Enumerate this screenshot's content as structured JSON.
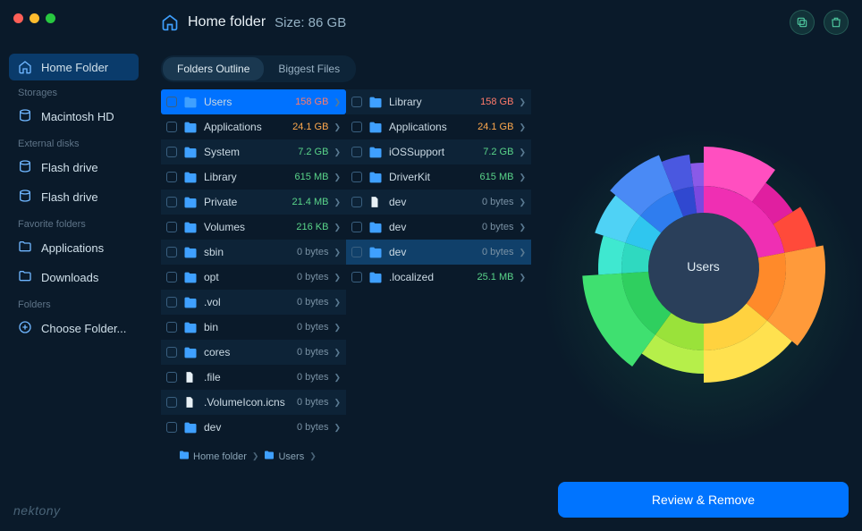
{
  "header": {
    "title": "Home folder",
    "size_label": "Size: 86 GB"
  },
  "sidebar": {
    "home_label": "Home Folder",
    "sections": [
      {
        "heading": "Storages",
        "items": [
          {
            "label": "Macintosh HD",
            "icon": "disk"
          }
        ]
      },
      {
        "heading": "External disks",
        "items": [
          {
            "label": "Flash drive",
            "icon": "disk"
          },
          {
            "label": "Flash drive",
            "icon": "disk"
          }
        ]
      },
      {
        "heading": "Favorite folders",
        "items": [
          {
            "label": "Applications",
            "icon": "folder"
          },
          {
            "label": "Downloads",
            "icon": "folder"
          }
        ]
      },
      {
        "heading": "Folders",
        "items": [
          {
            "label": "Choose Folder...",
            "icon": "plus"
          }
        ]
      }
    ],
    "brand": "nektony"
  },
  "tabs": [
    {
      "label": "Folders Outline",
      "active": true
    },
    {
      "label": "Biggest Files",
      "active": false
    }
  ],
  "columns": [
    [
      {
        "name": "Users",
        "size": "158 GB",
        "sizeClass": "size-red",
        "icon": "folder",
        "selected": true
      },
      {
        "name": "Applications",
        "size": "24.1 GB",
        "sizeClass": "size-orange",
        "icon": "folder"
      },
      {
        "name": "System",
        "size": "7.2 GB",
        "sizeClass": "size-green",
        "icon": "folder"
      },
      {
        "name": "Library",
        "size": "615 MB",
        "sizeClass": "size-green",
        "icon": "folder"
      },
      {
        "name": "Private",
        "size": "21.4 MB",
        "sizeClass": "size-green",
        "icon": "folder"
      },
      {
        "name": "Volumes",
        "size": "216 KB",
        "sizeClass": "size-green",
        "icon": "folder"
      },
      {
        "name": "sbin",
        "size": "0 bytes",
        "sizeClass": "size-dim",
        "icon": "folder"
      },
      {
        "name": "opt",
        "size": "0 bytes",
        "sizeClass": "size-dim",
        "icon": "folder"
      },
      {
        "name": ".vol",
        "size": "0 bytes",
        "sizeClass": "size-dim",
        "icon": "folder"
      },
      {
        "name": "bin",
        "size": "0 bytes",
        "sizeClass": "size-dim",
        "icon": "folder"
      },
      {
        "name": "cores",
        "size": "0 bytes",
        "sizeClass": "size-dim",
        "icon": "folder"
      },
      {
        "name": ".file",
        "size": "0 bytes",
        "sizeClass": "size-dim",
        "icon": "file"
      },
      {
        "name": ".VolumeIcon.icns",
        "size": "0 bytes",
        "sizeClass": "size-dim",
        "icon": "file"
      },
      {
        "name": "dev",
        "size": "0 bytes",
        "sizeClass": "size-dim",
        "icon": "folder"
      }
    ],
    [
      {
        "name": "Library",
        "size": "158 GB",
        "sizeClass": "size-red",
        "icon": "folder"
      },
      {
        "name": "Applications",
        "size": "24.1 GB",
        "sizeClass": "size-orange",
        "icon": "folder"
      },
      {
        "name": "iOSSupport",
        "size": "7.2 GB",
        "sizeClass": "size-green",
        "icon": "folder"
      },
      {
        "name": "DriverKit",
        "size": "615 MB",
        "sizeClass": "size-green",
        "icon": "folder"
      },
      {
        "name": "dev",
        "size": "0 bytes",
        "sizeClass": "size-dim",
        "icon": "file"
      },
      {
        "name": "dev",
        "size": "0 bytes",
        "sizeClass": "size-dim",
        "icon": "folder"
      },
      {
        "name": "dev",
        "size": "0 bytes",
        "sizeClass": "size-dim",
        "icon": "folder",
        "highlighted": true
      },
      {
        "name": ".localized",
        "size": "25.1 MB",
        "sizeClass": "size-green",
        "icon": "folder"
      }
    ]
  ],
  "breadcrumb": [
    {
      "label": "Home folder"
    },
    {
      "label": "Users"
    }
  ],
  "chart_data": {
    "type": "sunburst",
    "center_label": "Users",
    "rings": [
      [
        {
          "label": "magenta",
          "value": 22,
          "color": "#ef2fb3"
        },
        {
          "label": "orange",
          "value": 14,
          "color": "#ff8a2a"
        },
        {
          "label": "yellow",
          "value": 14,
          "color": "#ffd23f"
        },
        {
          "label": "lime",
          "value": 10,
          "color": "#9ae23a"
        },
        {
          "label": "green",
          "value": 14,
          "color": "#2fcf5f"
        },
        {
          "label": "teal",
          "value": 6,
          "color": "#2fd9c0"
        },
        {
          "label": "cyan",
          "value": 6,
          "color": "#2fc6ef"
        },
        {
          "label": "blue",
          "value": 8,
          "color": "#2f7def"
        },
        {
          "label": "navy",
          "value": 4,
          "color": "#3048d0"
        },
        {
          "label": "purple",
          "value": 2,
          "color": "#7a49e0"
        }
      ],
      [
        {
          "label": "magenta-a",
          "value": 10,
          "color": "#ff4fc0"
        },
        {
          "label": "magenta-b",
          "value": 6,
          "color": "#e01fa0"
        },
        {
          "label": "red",
          "value": 6,
          "color": "#ff4a3a"
        },
        {
          "label": "orange2",
          "value": 14,
          "color": "#ff9a3a"
        },
        {
          "label": "yellow2",
          "value": 14,
          "color": "#ffe14f"
        },
        {
          "label": "lime2",
          "value": 10,
          "color": "#b6ef4a"
        },
        {
          "label": "green2",
          "value": 14,
          "color": "#3fe070"
        },
        {
          "label": "teal2",
          "value": 6,
          "color": "#3fe8d0"
        },
        {
          "label": "cyan2",
          "value": 6,
          "color": "#4fd2f5"
        },
        {
          "label": "blue2",
          "value": 8,
          "color": "#4a8af5"
        },
        {
          "label": "navy2",
          "value": 4,
          "color": "#4a58e0"
        },
        {
          "label": "purple2",
          "value": 2,
          "color": "#8a5ae8"
        }
      ]
    ]
  },
  "review_button": "Review & Remove"
}
